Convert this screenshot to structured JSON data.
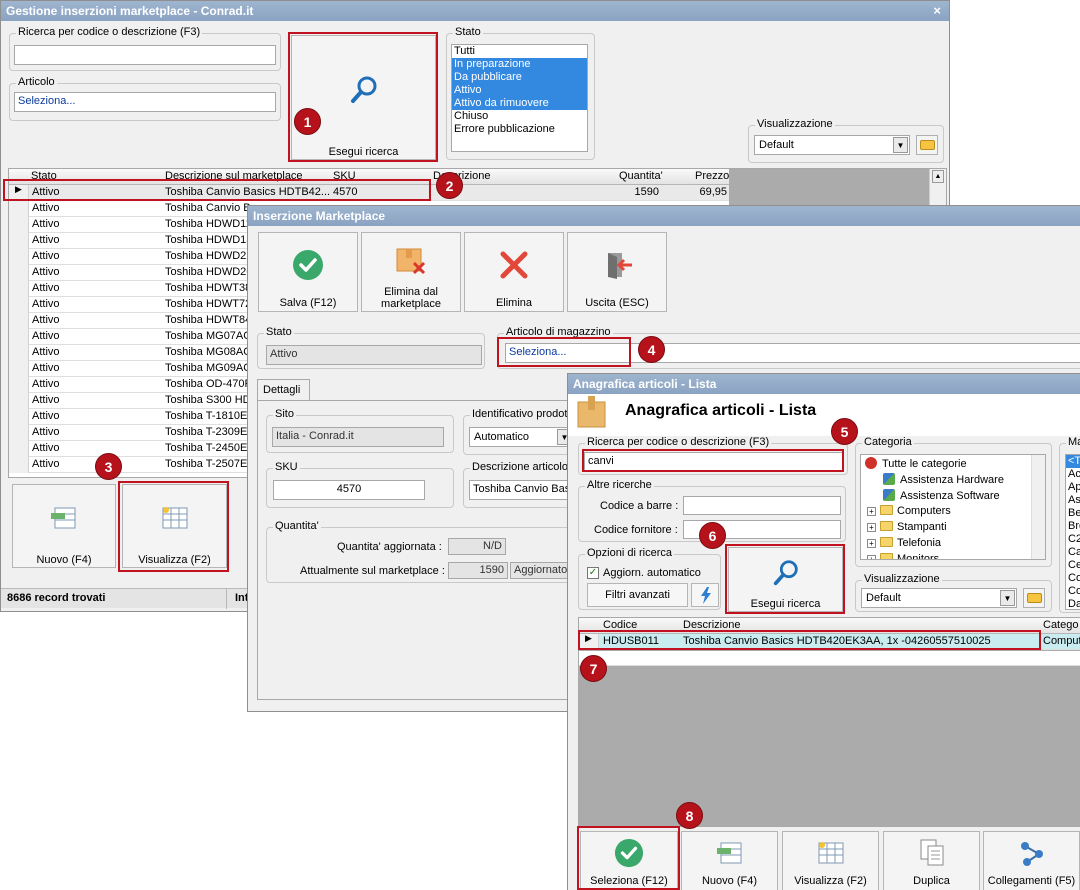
{
  "main": {
    "title": "Gestione inserzioni marketplace - Conrad.it",
    "close": "×",
    "search_label": "Ricerca per codice o descrizione (F3)",
    "search_value": "",
    "articolo_label": "Articolo",
    "articolo_value": "Seleziona...",
    "esegui_label": "Esegui ricerca",
    "stato_label": "Stato",
    "stato_options": [
      {
        "label": "Tutti",
        "selected": false
      },
      {
        "label": "In preparazione",
        "selected": true
      },
      {
        "label": "Da pubblicare",
        "selected": true
      },
      {
        "label": "Attivo",
        "selected": true
      },
      {
        "label": "Attivo da rimuovere",
        "selected": true
      },
      {
        "label": "Chiuso",
        "selected": false
      },
      {
        "label": "Errore pubblicazione",
        "selected": false
      }
    ],
    "visualizzazione_label": "Visualizzazione",
    "visualizzazione_value": "Default",
    "columns": [
      "Stato",
      "Descrizione sul marketplace",
      "SKU",
      "Descrizione",
      "Quantita'",
      "Prezzo"
    ],
    "first_row": {
      "stato": "Attivo",
      "desc": "Toshiba Canvio Basics HDTB42...",
      "sku": "4570",
      "descr": "",
      "qty": "1590",
      "price": "69,95"
    },
    "rows": [
      {
        "stato": "Attivo",
        "desc": "Toshiba Canvio B"
      },
      {
        "stato": "Attivo",
        "desc": "Toshiba HDWD11"
      },
      {
        "stato": "Attivo",
        "desc": "Toshiba HDWD13"
      },
      {
        "stato": "Attivo",
        "desc": "Toshiba HDWD22"
      },
      {
        "stato": "Attivo",
        "desc": "Toshiba HDWD26"
      },
      {
        "stato": "Attivo",
        "desc": "Toshiba HDWT38"
      },
      {
        "stato": "Attivo",
        "desc": "Toshiba HDWT72"
      },
      {
        "stato": "Attivo",
        "desc": "Toshiba HDWT84"
      },
      {
        "stato": "Attivo",
        "desc": "Toshiba MG07AC"
      },
      {
        "stato": "Attivo",
        "desc": "Toshiba MG08AC"
      },
      {
        "stato": "Attivo",
        "desc": "Toshiba MG09AC"
      },
      {
        "stato": "Attivo",
        "desc": "Toshiba OD-470P"
      },
      {
        "stato": "Attivo",
        "desc": "Toshiba S300 HD"
      },
      {
        "stato": "Attivo",
        "desc": "Toshiba T-1810E"
      },
      {
        "stato": "Attivo",
        "desc": "Toshiba T-2309E"
      },
      {
        "stato": "Attivo",
        "desc": "Toshiba T-2450E"
      },
      {
        "stato": "Attivo",
        "desc": "Toshiba T-2507E"
      }
    ],
    "nuovo_label": "Nuovo (F4)",
    "visualizza_label": "Visualizza (F2)",
    "records": "8686 record trovati",
    "status_extra": "Int"
  },
  "ins": {
    "title": "Inserzione Marketplace",
    "salva": "Salva (F12)",
    "elimina_dal": "Elimina dal",
    "marketplace": "marketplace",
    "elimina": "Elimina",
    "uscita": "Uscita (ESC)",
    "stato_label": "Stato",
    "stato_value": "Attivo",
    "articolo_label": "Articolo di magazzino",
    "articolo_value": "Seleziona...",
    "tab": "Dettagli",
    "sito_label": "Sito",
    "sito_value": "Italia - Conrad.it",
    "ident_label": "Identificativo prodott",
    "ident_value": "Automatico",
    "sku_label": "SKU",
    "sku_value": "4570",
    "descart_label": "Descrizione articolo su",
    "descart_value": "Toshiba Canvio Basic",
    "qty_label": "Quantita'",
    "qty_agg_label": "Quantita' aggiornata :",
    "qty_agg_value": "N/D",
    "qty_att_label": "Attualmente sul marketplace :",
    "qty_att_value": "1590",
    "aggiornato": "Aggiornato"
  },
  "ana": {
    "title": "Anagrafica articoli  - Lista",
    "heading": "Anagrafica articoli  - Lista",
    "search_label": "Ricerca per codice o descrizione (F3)",
    "search_value": "canvi",
    "altre_label": "Altre ricerche",
    "barcode_label": "Codice a barre :",
    "fornitore_label": "Codice fornitore :",
    "opzioni_label": "Opzioni di ricerca",
    "aggiorn_label": "Aggiorn. automatico",
    "filtri_label": "Filtri avanzati",
    "esegui_label": "Esegui ricerca",
    "categoria_label": "Categoria",
    "categories": [
      "Tutte le categorie",
      "Assistenza Hardware",
      "Assistenza Software",
      "Computers",
      "Stampanti",
      "Telefonia",
      "Monitors"
    ],
    "visual_label": "Visualizzazione",
    "visual_value": "Default",
    "marca_label": "Ma",
    "marca_items": [
      "<T",
      "Ac",
      "Ap",
      "As",
      "Be",
      "Bro",
      "C2",
      "Ca",
      "Ce",
      "Co",
      "Co",
      "Da"
    ],
    "columns": [
      "Codice",
      "Descrizione",
      "Catego"
    ],
    "row": {
      "code": "HDUSB011",
      "desc": "Toshiba Canvio Basics HDTB420EK3AA, 1x -04260557510025",
      "cat": "Comput"
    },
    "seleziona": "Seleziona (F12)",
    "nuovo": "Nuovo (F4)",
    "visualizza": "Visualizza (F2)",
    "duplica": "Duplica",
    "collegamenti": "Collegamenti (F5)"
  },
  "badges": [
    "1",
    "2",
    "3",
    "4",
    "5",
    "6",
    "7",
    "8"
  ],
  "colors": {
    "highlight": "#c1121f",
    "badge": "#b5121b",
    "titlebar": "#8aa3c2",
    "selection": "#3388e0"
  }
}
